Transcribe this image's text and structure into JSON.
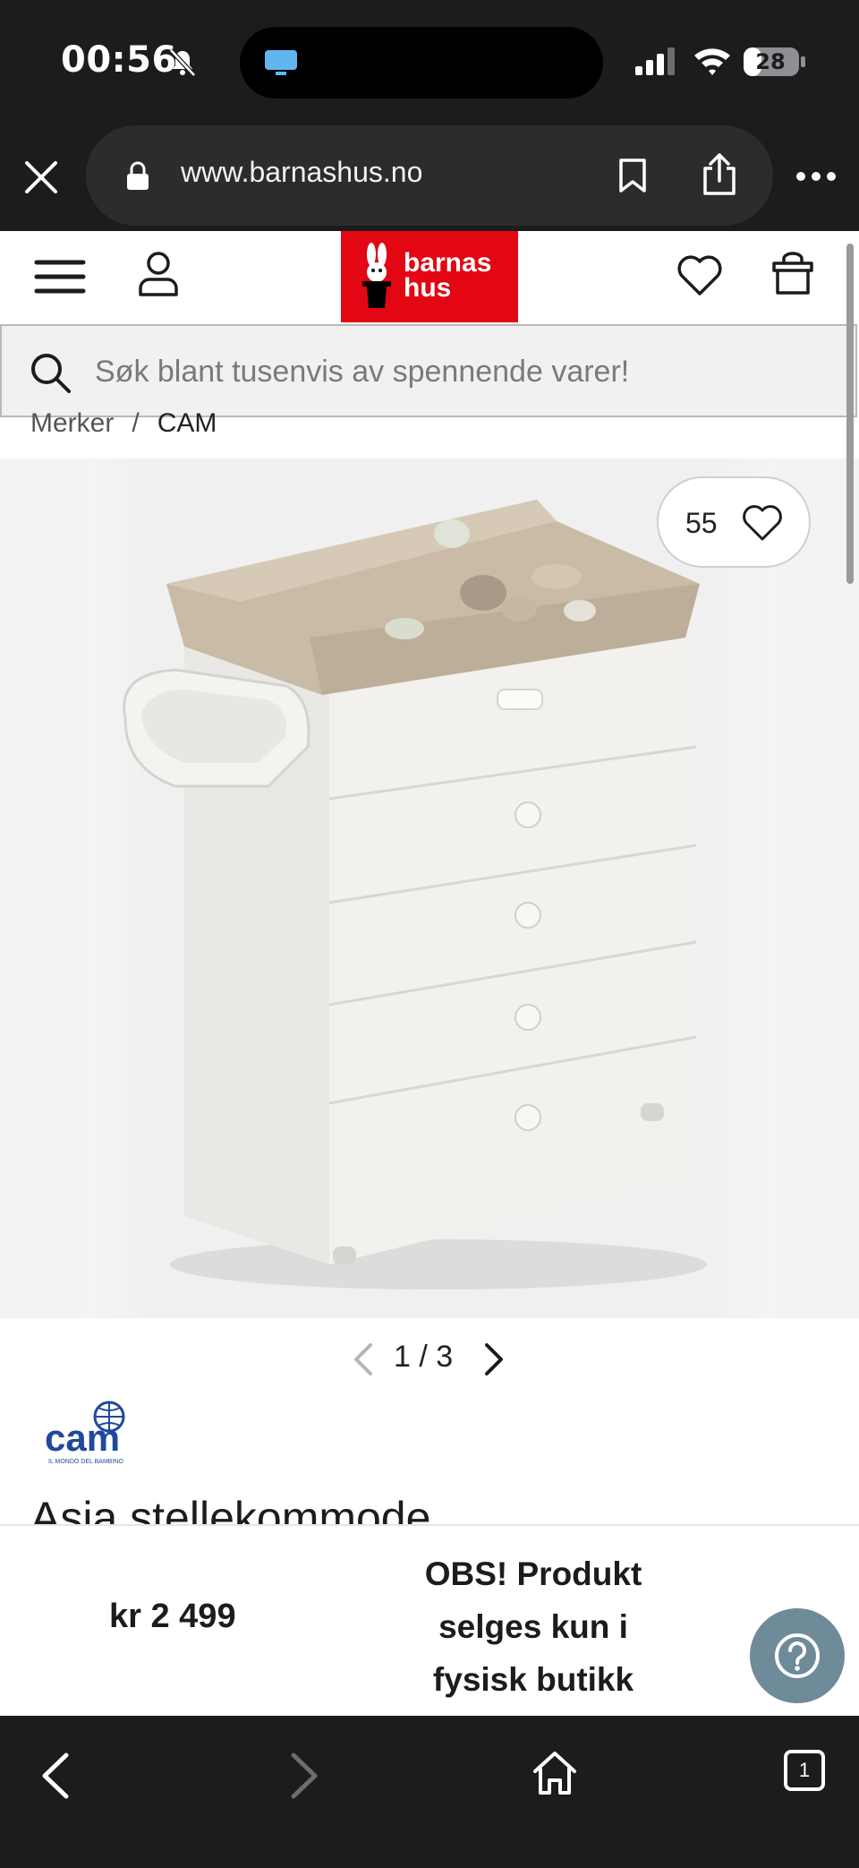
{
  "status_bar": {
    "time": "00:56",
    "battery": "28"
  },
  "browser": {
    "url": "www.barnashus.no",
    "tab_count": "1"
  },
  "header": {
    "logo_line1": "barnas",
    "logo_line2": "hus"
  },
  "search": {
    "placeholder": "Søk blant tusenvis av spennende varer!"
  },
  "breadcrumb": {
    "items": [
      "Merker",
      "CAM"
    ],
    "separator": "/"
  },
  "product": {
    "like_count": "55",
    "pager_current": "1",
    "pager_sep": "/",
    "pager_total": "3",
    "brand_name": "cam",
    "brand_tagline": "IL MONDO DEL BAMBINO",
    "title": "Asia stellekommode"
  },
  "sticky": {
    "price": "kr 2 499",
    "notice": "OBS! Produkt selges kun i fysisk butikk"
  },
  "colors": {
    "brand_red": "#e30613",
    "help_button": "#6f8a99",
    "browser_chrome": "#1c1c1e",
    "cam_blue": "#1f4a9c"
  }
}
